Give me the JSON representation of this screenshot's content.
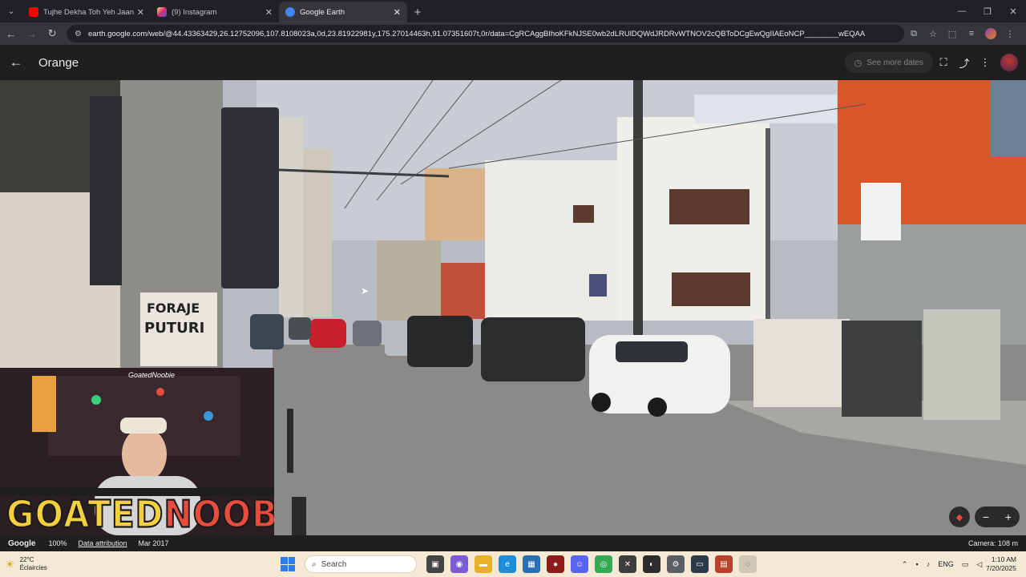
{
  "browser": {
    "tabs": [
      {
        "label": "Tujhe Dekha Toh Yeh Jaana Sanam",
        "favicon_color": "#ff0000",
        "active": false
      },
      {
        "label": "(9) Instagram",
        "favicon_color": "#e1306c",
        "active": false
      },
      {
        "label": "Google Earth",
        "favicon_color": "#4285f4",
        "active": true
      }
    ],
    "url": "earth.google.com/web/@44.43363429,26.12752096,107.8108023a,0d,23.81922981y,175.27014463h,91.07351607t,0r/data=CgRCAggBIhoKFkNJSE0wb2dLRUlDQWdJRDRvWTNOV2cQBToDCgEwQgIIAEoNCP________wEQAA"
  },
  "earth": {
    "title": "Orange",
    "see_more_dates": "See more dates",
    "footer": {
      "logo": "Google",
      "zoom": "100%",
      "attribution": "Data attribution",
      "date": "Mar 2017",
      "camera": "Camera: 108 m"
    }
  },
  "webcam": {
    "handle": "GoatedNoobie",
    "brand_part1": "GOATED",
    "brand_part2": "NOOBIE"
  },
  "taskbar": {
    "weather_temp": "22°C",
    "weather_desc": "Éclaircies",
    "search_placeholder": "Search",
    "lang": "ENG",
    "time": "1:10 AM",
    "date": "7/20/2025"
  },
  "colors": {
    "brand_yellow": "#f4d03f",
    "brand_red": "#e74c3c",
    "accent_blue": "#4285f4"
  }
}
